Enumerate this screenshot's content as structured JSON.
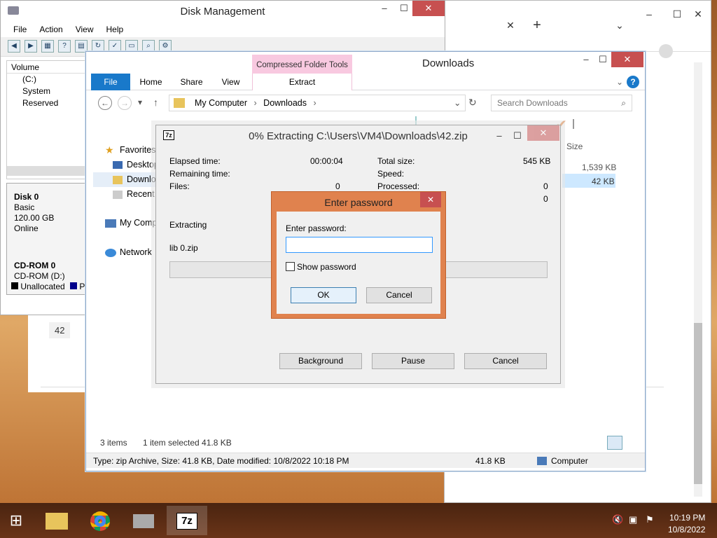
{
  "chrome": {
    "minimize": "–",
    "maximize": "☐",
    "close": "✕",
    "tab_close": "✕",
    "new_tab": "+",
    "down": "⌄",
    "label_42": "42"
  },
  "diskmgmt": {
    "title": "Disk Management",
    "menu": [
      "File",
      "Action",
      "View",
      "Help"
    ],
    "column_volume": "Volume",
    "volumes": [
      "(C:)",
      "System Reserved"
    ],
    "disk0": {
      "name": "Disk 0",
      "type": "Basic",
      "size": "120.00 GB",
      "status": "Online"
    },
    "cdrom0": {
      "name": "CD-ROM 0",
      "drive": "CD-ROM (D:)"
    },
    "legend_unallocated": "Unallocated",
    "legend_p": "P"
  },
  "explorer": {
    "title": "Downloads",
    "cft": "Compressed Folder Tools",
    "tabs": [
      "File",
      "Home",
      "Share",
      "View"
    ],
    "extract_tab": "Extract",
    "address": [
      "My Computer",
      "Downloads"
    ],
    "search_placeholder": "Search Downloads",
    "nav": [
      "Favorites",
      "Desktop",
      "Downlo",
      "Recent p",
      "My Comp",
      "Network"
    ],
    "col_size": "Size",
    "sizes": [
      "1,539 KB",
      "42 KB"
    ],
    "status_items": "3 items",
    "status_selected": "1 item selected  41.8 KB",
    "details": "Type: zip Archive, Size: 41.8 KB, Date modified: 10/8/2022 10:18 PM",
    "details_size": "41.8 KB",
    "details_loc": "Computer"
  },
  "zip": {
    "icon": "7z",
    "title": "0% Extracting C:\\Users\\VM4\\Downloads\\42.zip",
    "elapsed_label": "Elapsed time:",
    "elapsed_value": "00:00:04",
    "remaining_label": "Remaining time:",
    "files_label": "Files:",
    "files_value": "0",
    "total_label": "Total size:",
    "total_value": "545 KB",
    "speed_label": "Speed:",
    "processed_label": "Processed:",
    "processed_value": "0",
    "row4_value": "0",
    "extracting_label": "Extracting",
    "current_file": "lib 0.zip",
    "progress": 0,
    "btn_background": "Background",
    "btn_pause": "Pause",
    "btn_cancel": "Cancel"
  },
  "password": {
    "title": "Enter password",
    "label": "Enter password:",
    "value": "",
    "show_label": "Show password",
    "ok": "OK",
    "cancel": "Cancel"
  },
  "taskbar": {
    "time": "10:19 PM",
    "date": "10/8/2022",
    "zip_label": "7z"
  }
}
